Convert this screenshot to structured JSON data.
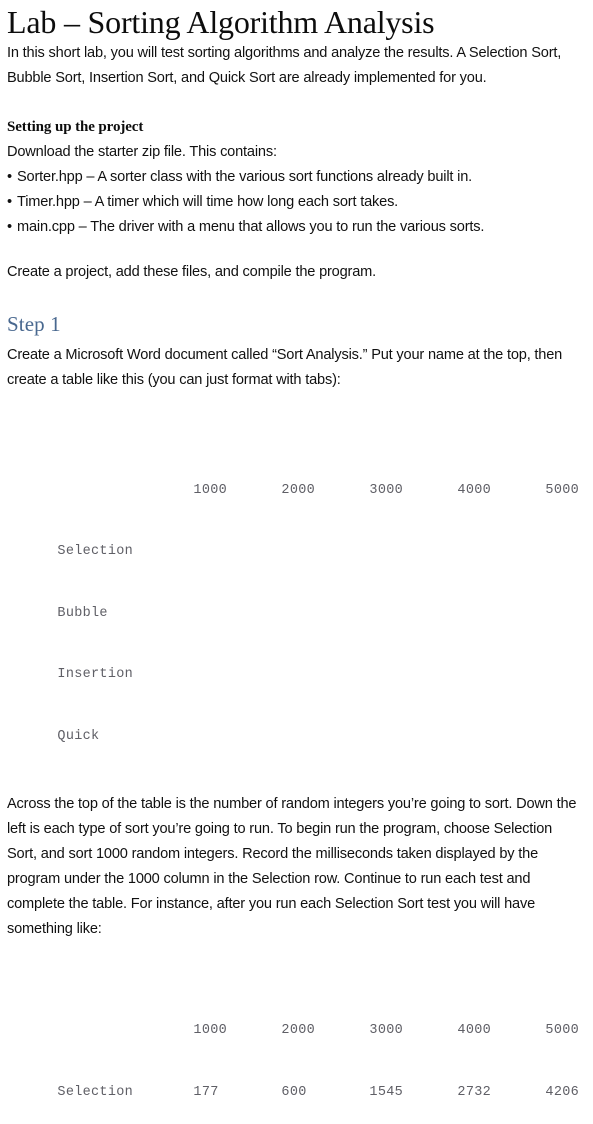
{
  "document": {
    "title": "Lab – Sorting Algorithm Analysis",
    "intro_paragraph": "In this short lab, you will test sorting algorithms and analyze the results. A Selection Sort, Bubble Sort, Insertion Sort, and Quick Sort are already implemented for you.",
    "setup": {
      "heading": "Setting up the project",
      "lead_in": "Download the starter zip file. This contains:",
      "files": [
        "Sorter.hpp – A sorter class with the various sort functions already built in.",
        "Timer.hpp – A timer which will time how long each sort takes.",
        "main.cpp – The driver with a menu that allows you to run the various sorts."
      ],
      "bullet_glyph": "•",
      "closing": "Create a project, add these files, and compile the program."
    },
    "step1": {
      "heading": "Step 1",
      "heading_color": "#49688f",
      "instruction": "Create a Microsoft Word document called “Sort Analysis.”  Put your name at the top, then create a table like this (you can just format with tabs):",
      "blank_table": {
        "column_headers": [
          "1000",
          "2000",
          "3000",
          "4000",
          "5000"
        ],
        "row_labels": [
          "Selection",
          "Bubble",
          "Insertion",
          "Quick"
        ],
        "rows": [
          [
            "",
            "",
            "",
            "",
            ""
          ],
          [
            "",
            "",
            "",
            "",
            ""
          ],
          [
            "",
            "",
            "",
            "",
            ""
          ],
          [
            "",
            "",
            "",
            "",
            ""
          ]
        ]
      },
      "explanation": "Across the top of the table is the number of random integers you’re going to sort.  Down the left is each type of sort you’re going to run.  To begin run the program, choose Selection Sort, and sort 1000 random integers. Record the milliseconds taken displayed by the program under the 1000 column in the Selection row.  Continue to run each test and complete the table.  For instance, after you run each Selection Sort test you will have something like:",
      "example_table": {
        "column_headers": [
          "1000",
          "2000",
          "3000",
          "4000",
          "5000"
        ],
        "row_labels": [
          "Selection"
        ],
        "rows": [
          [
            "177",
            "600",
            "1545",
            "2732",
            "4206"
          ]
        ]
      }
    }
  }
}
